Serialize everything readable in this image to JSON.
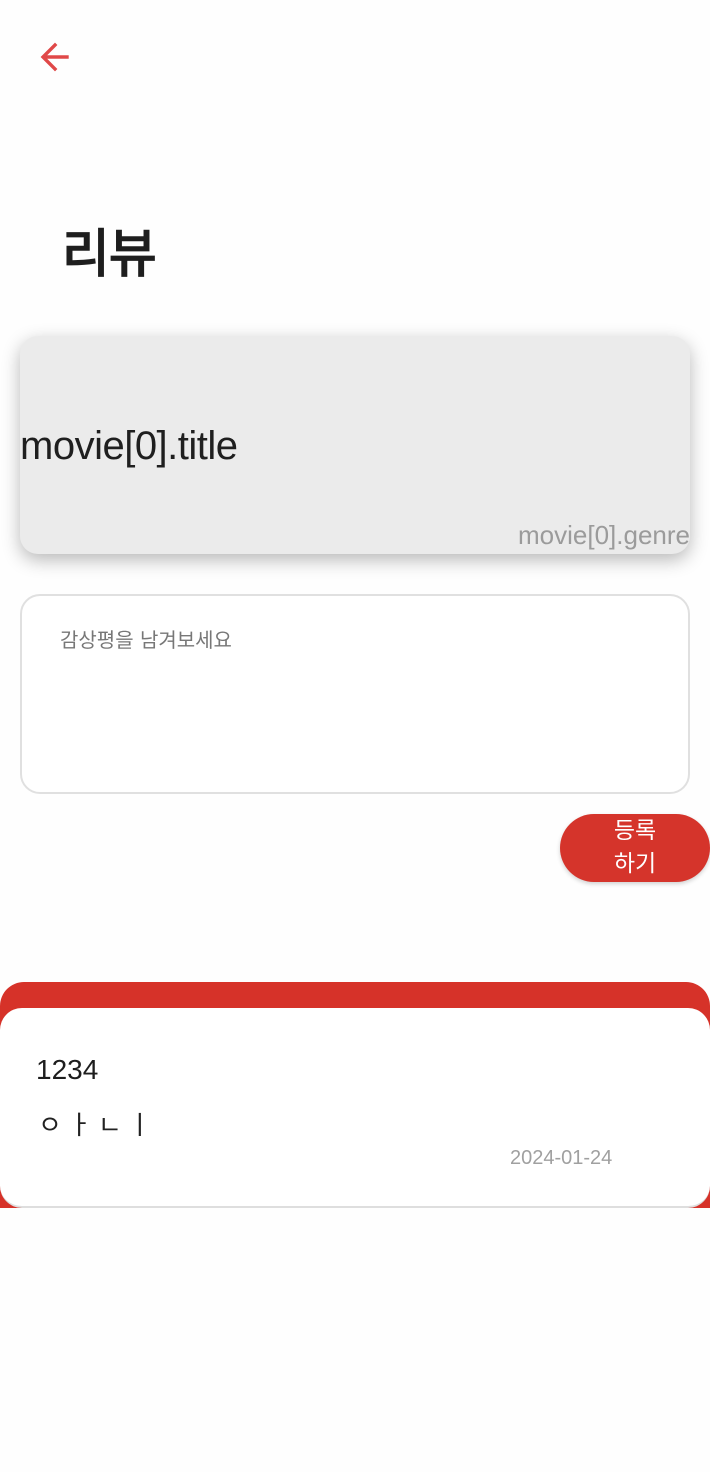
{
  "header": {
    "back_icon": "arrow-left-icon",
    "accent_color": "#e04848"
  },
  "page": {
    "title": "리뷰"
  },
  "movie_card": {
    "title": "movie[0].title",
    "genre": "movie[0].genre"
  },
  "review_form": {
    "placeholder": "감상평을 남겨보세요",
    "value": "",
    "submit_label": "등록하기",
    "submit_color": "#d5342b"
  },
  "reviews": {
    "panel_color": "#d63229",
    "items": [
      {
        "user": "1234",
        "content": "ㅇㅏㄴㅣ",
        "date": "2024-01-24"
      }
    ]
  }
}
